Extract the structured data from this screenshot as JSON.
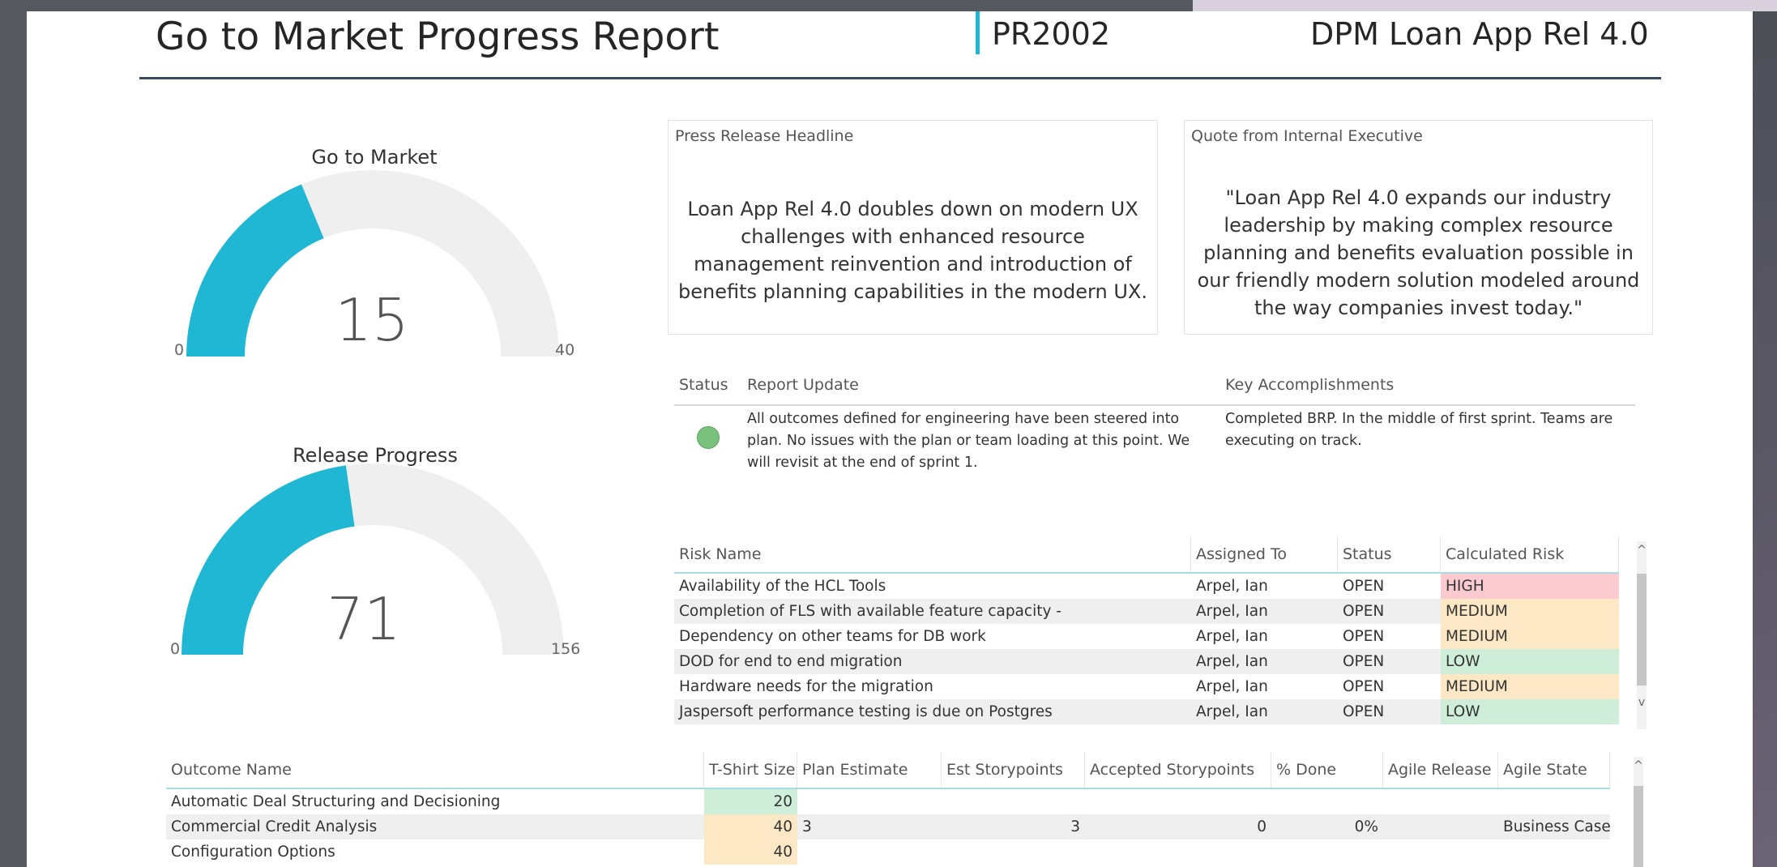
{
  "header": {
    "title": "Go to Market Progress Report",
    "code": "PR2002",
    "app_name": "DPM Loan App Rel 4.0"
  },
  "gauges": [
    {
      "title": "Go to Market",
      "value": 15,
      "min": 0,
      "max": 40,
      "value_label": "15",
      "min_label": "0",
      "max_label": "40"
    },
    {
      "title": "Release Progress",
      "value": 71,
      "min": 0,
      "max": 156,
      "value_label": "71",
      "min_label": "0",
      "max_label": "156"
    }
  ],
  "colors": {
    "gauge_fill": "#1fb7d4",
    "gauge_track": "#efefef",
    "accent": "#1fb7d4",
    "status_green": "#78c27e"
  },
  "press_release": {
    "label": "Press Release Headline",
    "text": "Loan App Rel 4.0 doubles down on modern UX challenges with enhanced resource management reinvention and introduction of benefits planning capabilities in the modern UX."
  },
  "quote": {
    "label": "Quote from Internal Executive",
    "text": "\"Loan App Rel 4.0 expands our industry leadership by making complex resource planning and benefits evaluation possible in our friendly modern solution modeled around the way companies invest today.\""
  },
  "status_table": {
    "headers": {
      "status": "Status",
      "update": "Report Update",
      "accomplishments": "Key Accomplishments"
    },
    "status_icon": "green-circle-icon",
    "update_text": "All outcomes defined for engineering have been steered into plan. No issues with the plan or team loading at this point. We will revisit at the end of sprint 1.",
    "accomplishments_text": "Completed BRP. In the middle of first sprint. Teams are executing on track."
  },
  "risk_table": {
    "headers": [
      "Risk Name",
      "Assigned To",
      "Status",
      "Calculated Risk"
    ],
    "rows": [
      [
        "Availability of the HCL Tools",
        "Arpel, Ian",
        "OPEN",
        "HIGH"
      ],
      [
        "Completion of FLS with available feature capacity -",
        "Arpel, Ian",
        "OPEN",
        "MEDIUM"
      ],
      [
        "Dependency on other teams for DB work",
        "Arpel, Ian",
        "OPEN",
        "MEDIUM"
      ],
      [
        "DOD for end to end migration",
        "Arpel, Ian",
        "OPEN",
        "LOW"
      ],
      [
        "Hardware needs for the migration",
        "Arpel, Ian",
        "OPEN",
        "MEDIUM"
      ],
      [
        "Jaspersoft performance testing is due on Postgres",
        "Arpel, Ian",
        "OPEN",
        "LOW"
      ]
    ],
    "scroll_up": "^",
    "scroll_down": "v"
  },
  "outcome_table": {
    "headers": [
      "Outcome Name",
      "T-Shirt Size",
      "Plan Estimate",
      "Est Storypoints",
      "Accepted Storypoints",
      "% Done",
      "Agile Release",
      "Agile State"
    ],
    "rows": [
      [
        "Automatic Deal Structuring and Decisioning",
        "20",
        "",
        "",
        "",
        "",
        "",
        ""
      ],
      [
        "Commercial Credit Analysis",
        "40",
        "3",
        "3",
        "0",
        "0%",
        "",
        "Business Case"
      ],
      [
        "Configuration Options",
        "40",
        "",
        "",
        "",
        "",
        "",
        ""
      ]
    ],
    "scroll_up": "^"
  }
}
